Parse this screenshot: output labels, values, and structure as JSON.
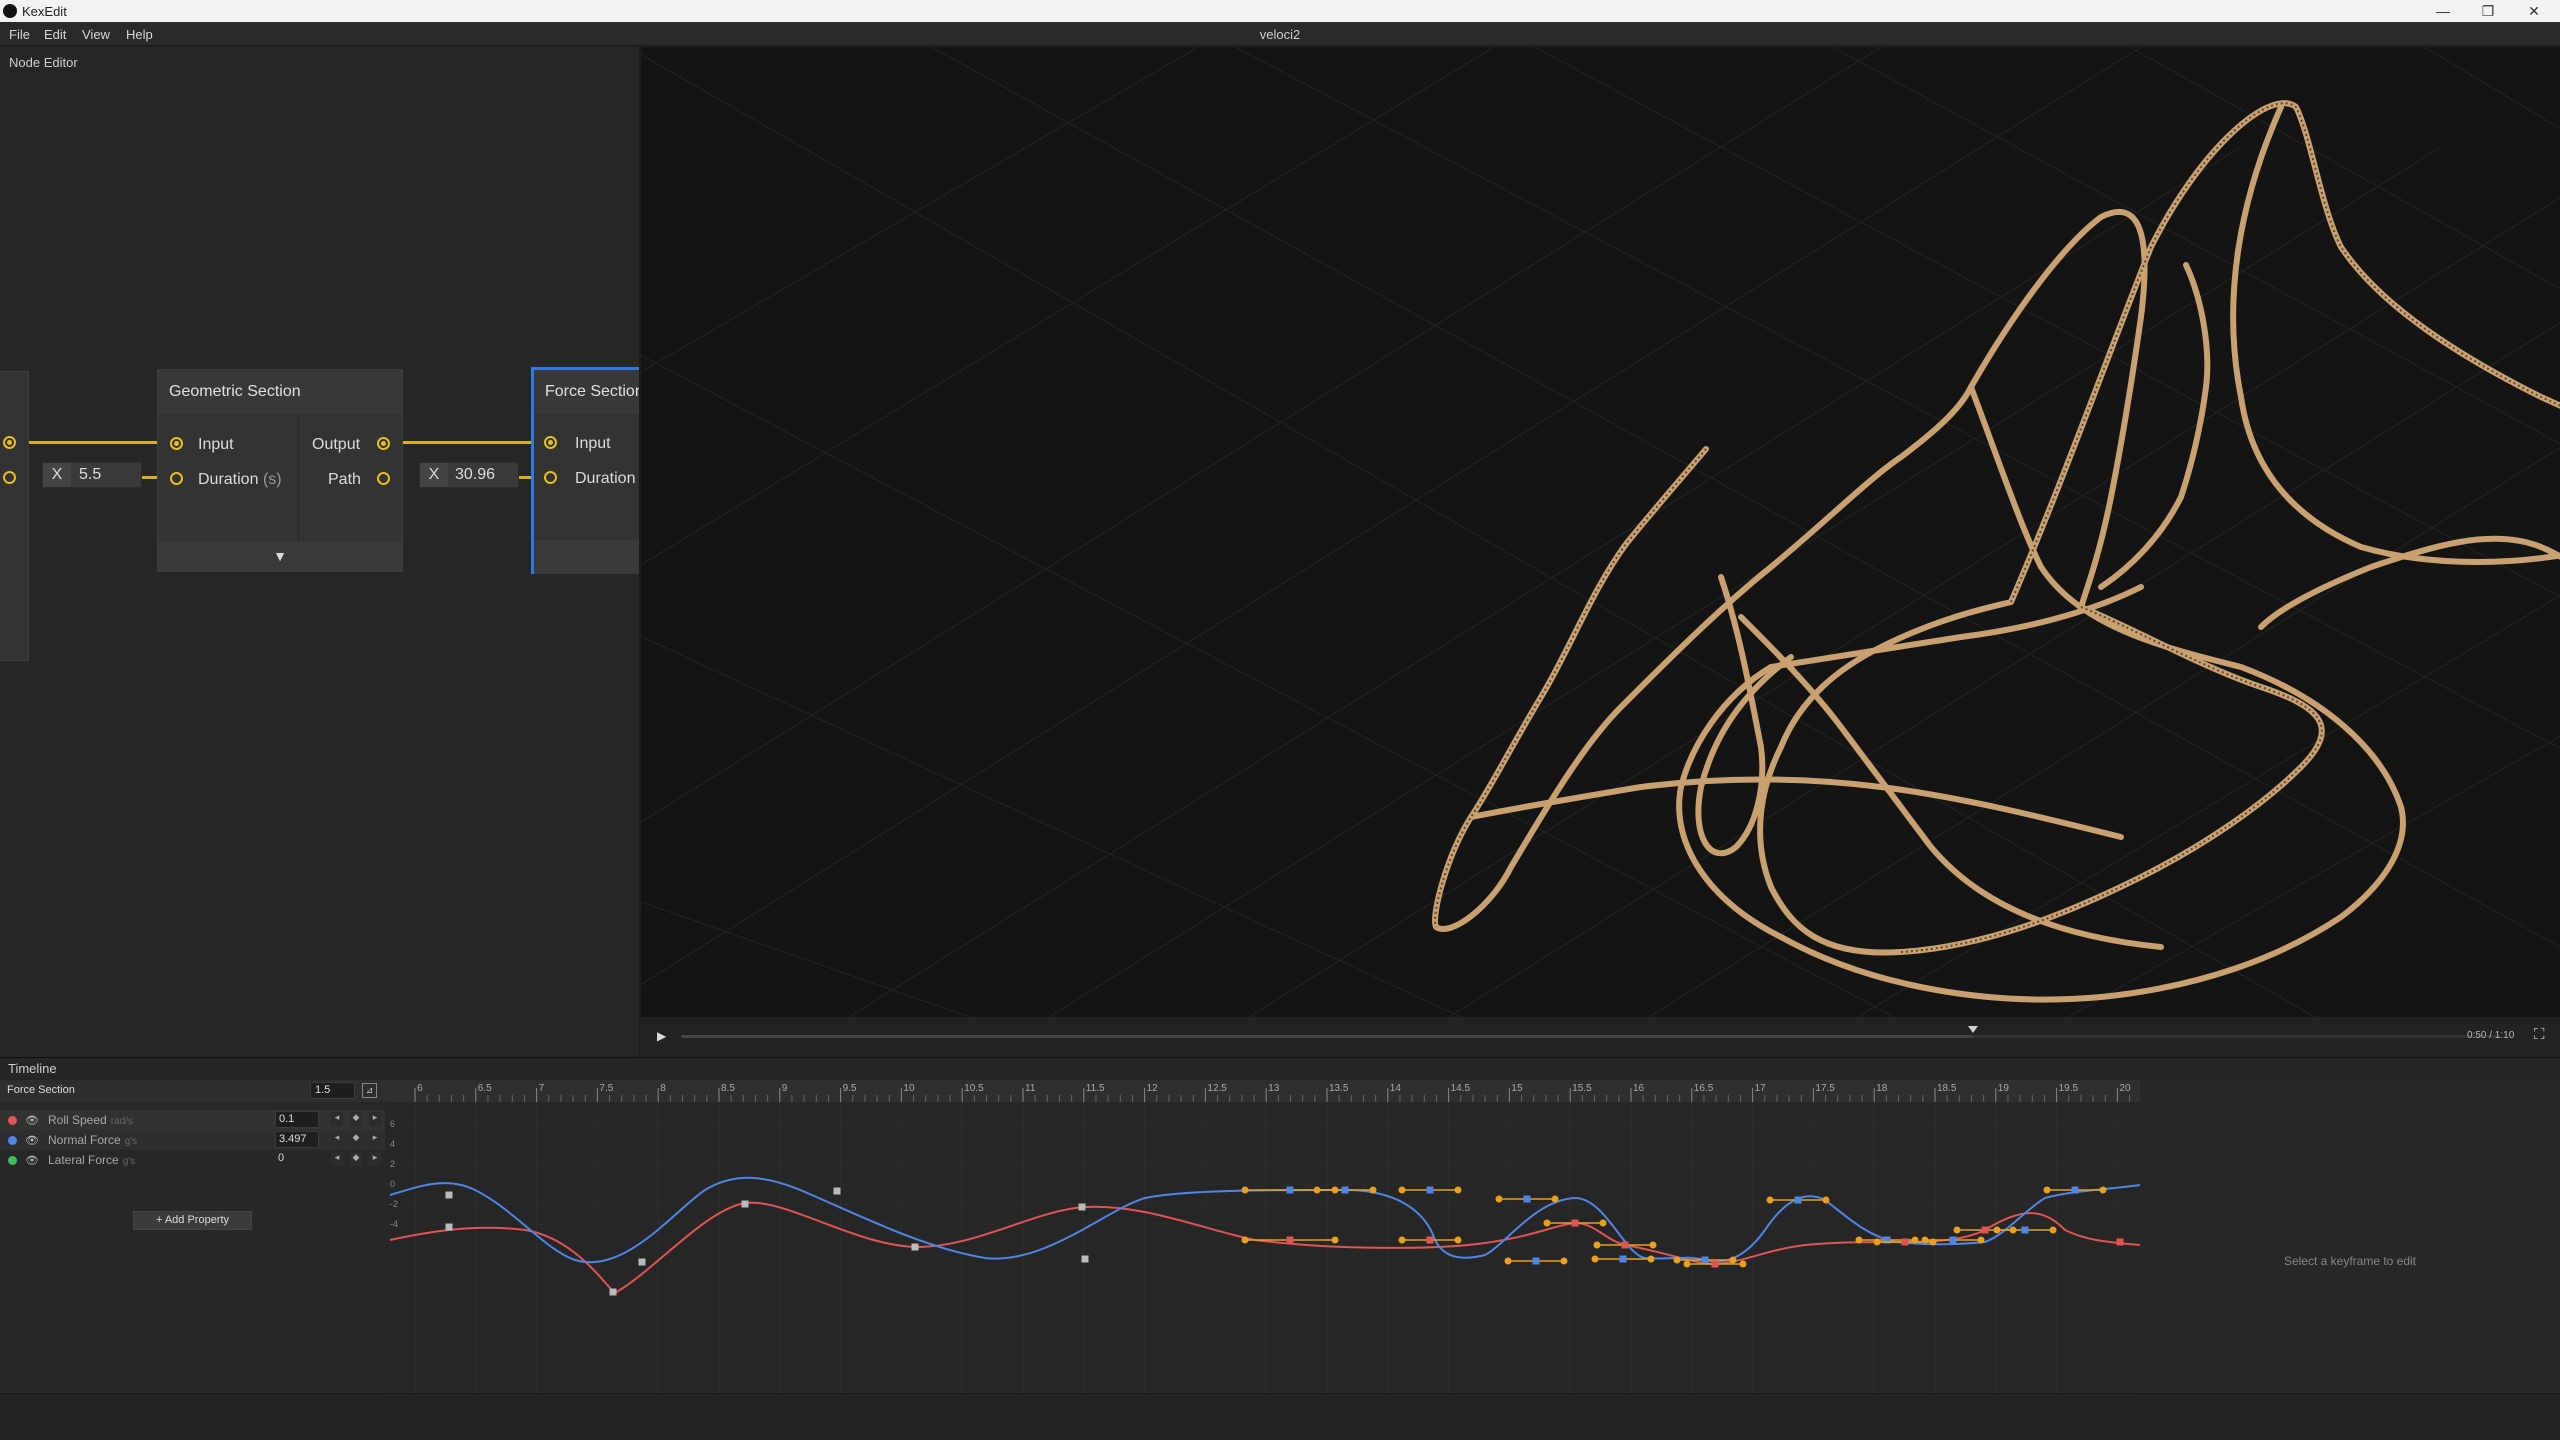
{
  "window": {
    "app_name": "KexEdit",
    "minimize": "—",
    "maximize": "❐",
    "close": "✕"
  },
  "menu": {
    "items": [
      "File",
      "Edit",
      "View",
      "Help"
    ],
    "document_title": "veloci2"
  },
  "node_editor": {
    "label": "Node Editor",
    "left_field_value": "5.5",
    "geometric_section": {
      "title": "Geometric Section",
      "input": "Input",
      "duration": "Duration",
      "duration_unit": "(s)",
      "output": "Output",
      "path": "Path",
      "expand_glyph": "▼"
    },
    "mid_field_value": "30.96",
    "force_section": {
      "title": "Force Section",
      "input": "Input",
      "duration": "Duration"
    },
    "x_label": "X"
  },
  "playback": {
    "play_glyph": "▶",
    "time": "0:50 / 1:10",
    "fullscreen_glyph": "⛶",
    "progress": 0.71
  },
  "timeline": {
    "label": "Timeline",
    "section_name": "Force Section",
    "section_value": "1.5",
    "properties": [
      {
        "name": "Roll Speed",
        "unit": "rad/s",
        "value": "0.1",
        "color": "#e05454"
      },
      {
        "name": "Normal Force",
        "unit": "g's",
        "value": "3.497",
        "color": "#4f86e6"
      },
      {
        "name": "Lateral Force",
        "unit": "g's",
        "value": "0",
        "color": "#3fbf5a"
      }
    ],
    "add_property": "+ Add Property",
    "ruler_ticks": [
      "6",
      "6.5",
      "7",
      "7.5",
      "8",
      "8.5",
      "9",
      "9.5",
      "10",
      "10.5",
      "11",
      "11.5",
      "12",
      "12.5",
      "13",
      "13.5",
      "14",
      "14.5",
      "15",
      "15.5",
      "16",
      "16.5",
      "17",
      "17.5",
      "18",
      "18.5",
      "19",
      "19.5",
      "20"
    ],
    "y_ticks": [
      "6",
      "4",
      "2",
      "0",
      "-2",
      "-4"
    ],
    "hint": "Select a keyframe to edit"
  },
  "colors": {
    "track": "#c9a070",
    "roll": "#e05454",
    "normal": "#4f86e6",
    "handle": "#e8a020",
    "wire": "#d6b418",
    "selection": "#2f7ae0"
  }
}
